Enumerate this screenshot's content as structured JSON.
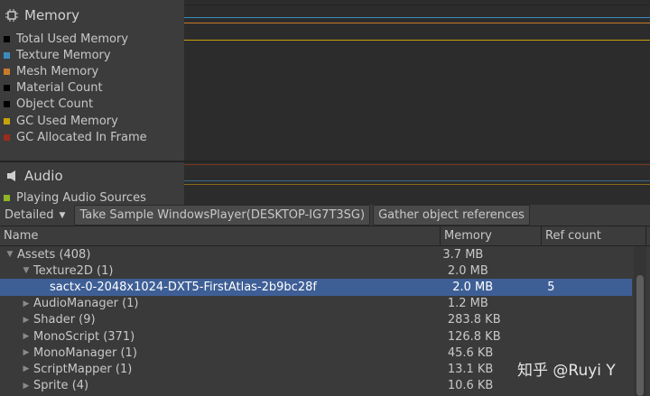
{
  "memory": {
    "title": "Memory",
    "legend": [
      {
        "label": "Total Used Memory",
        "color": "#000000"
      },
      {
        "label": "Texture Memory",
        "color": "#3a8cbf"
      },
      {
        "label": "Mesh Memory",
        "color": "#c87b2a"
      },
      {
        "label": "Material Count",
        "color": "#000000"
      },
      {
        "label": "Object Count",
        "color": "#000000"
      },
      {
        "label": "GC Used Memory",
        "color": "#c9a20a"
      },
      {
        "label": "GC Allocated In Frame",
        "color": "#9a2b1e"
      }
    ]
  },
  "audio": {
    "title": "Audio",
    "legend": [
      {
        "label": "Playing Audio Sources",
        "color": "#8fb528"
      }
    ]
  },
  "toolbar": {
    "view_mode": "Detailed",
    "take_sample": "Take Sample WindowsPlayer(DESKTOP-IG7T3SG)",
    "gather_refs": "Gather object references"
  },
  "table": {
    "columns": [
      "Name",
      "Memory",
      "Ref count"
    ],
    "rows": [
      {
        "name": "Assets (408)",
        "memory": "3.7 MB",
        "ref": "",
        "level": 0,
        "expanded": true,
        "has_children": true,
        "selected": false
      },
      {
        "name": "Texture2D (1)",
        "memory": "2.0 MB",
        "ref": "",
        "level": 1,
        "expanded": true,
        "has_children": true,
        "selected": false
      },
      {
        "name": "sactx-0-2048x1024-DXT5-FirstAtlas-2b9bc28f",
        "memory": "2.0 MB",
        "ref": "5",
        "level": 2,
        "expanded": false,
        "has_children": false,
        "selected": true
      },
      {
        "name": "AudioManager (1)",
        "memory": "1.2 MB",
        "ref": "",
        "level": 1,
        "expanded": false,
        "has_children": true,
        "selected": false
      },
      {
        "name": "Shader (9)",
        "memory": "283.8 KB",
        "ref": "",
        "level": 1,
        "expanded": false,
        "has_children": true,
        "selected": false
      },
      {
        "name": "MonoScript (371)",
        "memory": "126.8 KB",
        "ref": "",
        "level": 1,
        "expanded": false,
        "has_children": true,
        "selected": false
      },
      {
        "name": "MonoManager (1)",
        "memory": "45.6 KB",
        "ref": "",
        "level": 1,
        "expanded": false,
        "has_children": true,
        "selected": false
      },
      {
        "name": "ScriptMapper (1)",
        "memory": "13.1 KB",
        "ref": "",
        "level": 1,
        "expanded": false,
        "has_children": true,
        "selected": false
      },
      {
        "name": "Sprite (4)",
        "memory": "10.6 KB",
        "ref": "",
        "level": 1,
        "expanded": false,
        "has_children": true,
        "selected": false
      }
    ]
  },
  "watermark": "知乎 @Ruyi Y"
}
